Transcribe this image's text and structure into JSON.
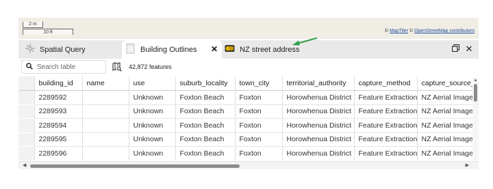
{
  "map": {
    "scale_metric": "2 m",
    "scale_imperial": "10 ft",
    "attribution_prefix": "© ",
    "attribution_maptiler": "MapTiler",
    "attribution_middle": " © ",
    "attribution_osm": "OpenStreetMap contributors"
  },
  "tabs": [
    {
      "label": "Spatial Query",
      "icon": "spatial-query-icon"
    },
    {
      "label": "Building Outlines",
      "icon": "building-layer-icon",
      "active": true
    },
    {
      "label": "NZ street address",
      "icon": "address-layer-icon"
    }
  ],
  "toolbar": {
    "search_placeholder": "Search table",
    "feature_count": "42,872 features"
  },
  "table": {
    "columns": [
      "building_id",
      "name",
      "use",
      "suburb_locality",
      "town_city",
      "territorial_authority",
      "capture_method",
      "capture_source_"
    ],
    "rows": [
      [
        "2289592",
        "",
        "Unknown",
        "Foxton Beach",
        "Foxton",
        "Horowhenua District",
        "Feature Extraction",
        "NZ Aerial Imager"
      ],
      [
        "2289593",
        "",
        "Unknown",
        "Foxton Beach",
        "Foxton",
        "Horowhenua District",
        "Feature Extraction",
        "NZ Aerial Imager"
      ],
      [
        "2289594",
        "",
        "Unknown",
        "Foxton Beach",
        "Foxton",
        "Horowhenua District",
        "Feature Extraction",
        "NZ Aerial Imager"
      ],
      [
        "2289595",
        "",
        "Unknown",
        "Foxton Beach",
        "Foxton",
        "Horowhenua District",
        "Feature Extraction",
        "NZ Aerial Imager"
      ],
      [
        "2289596",
        "",
        "Unknown",
        "Foxton Beach",
        "Foxton",
        "Horowhenua District",
        "Feature Extraction",
        "NZ Aerial Imager"
      ]
    ]
  },
  "colors": {
    "annotation_arrow": "#2e9e4a",
    "tabbar_bg": "#e9e9e9",
    "selection_column_bg": "#f2f2f2"
  }
}
